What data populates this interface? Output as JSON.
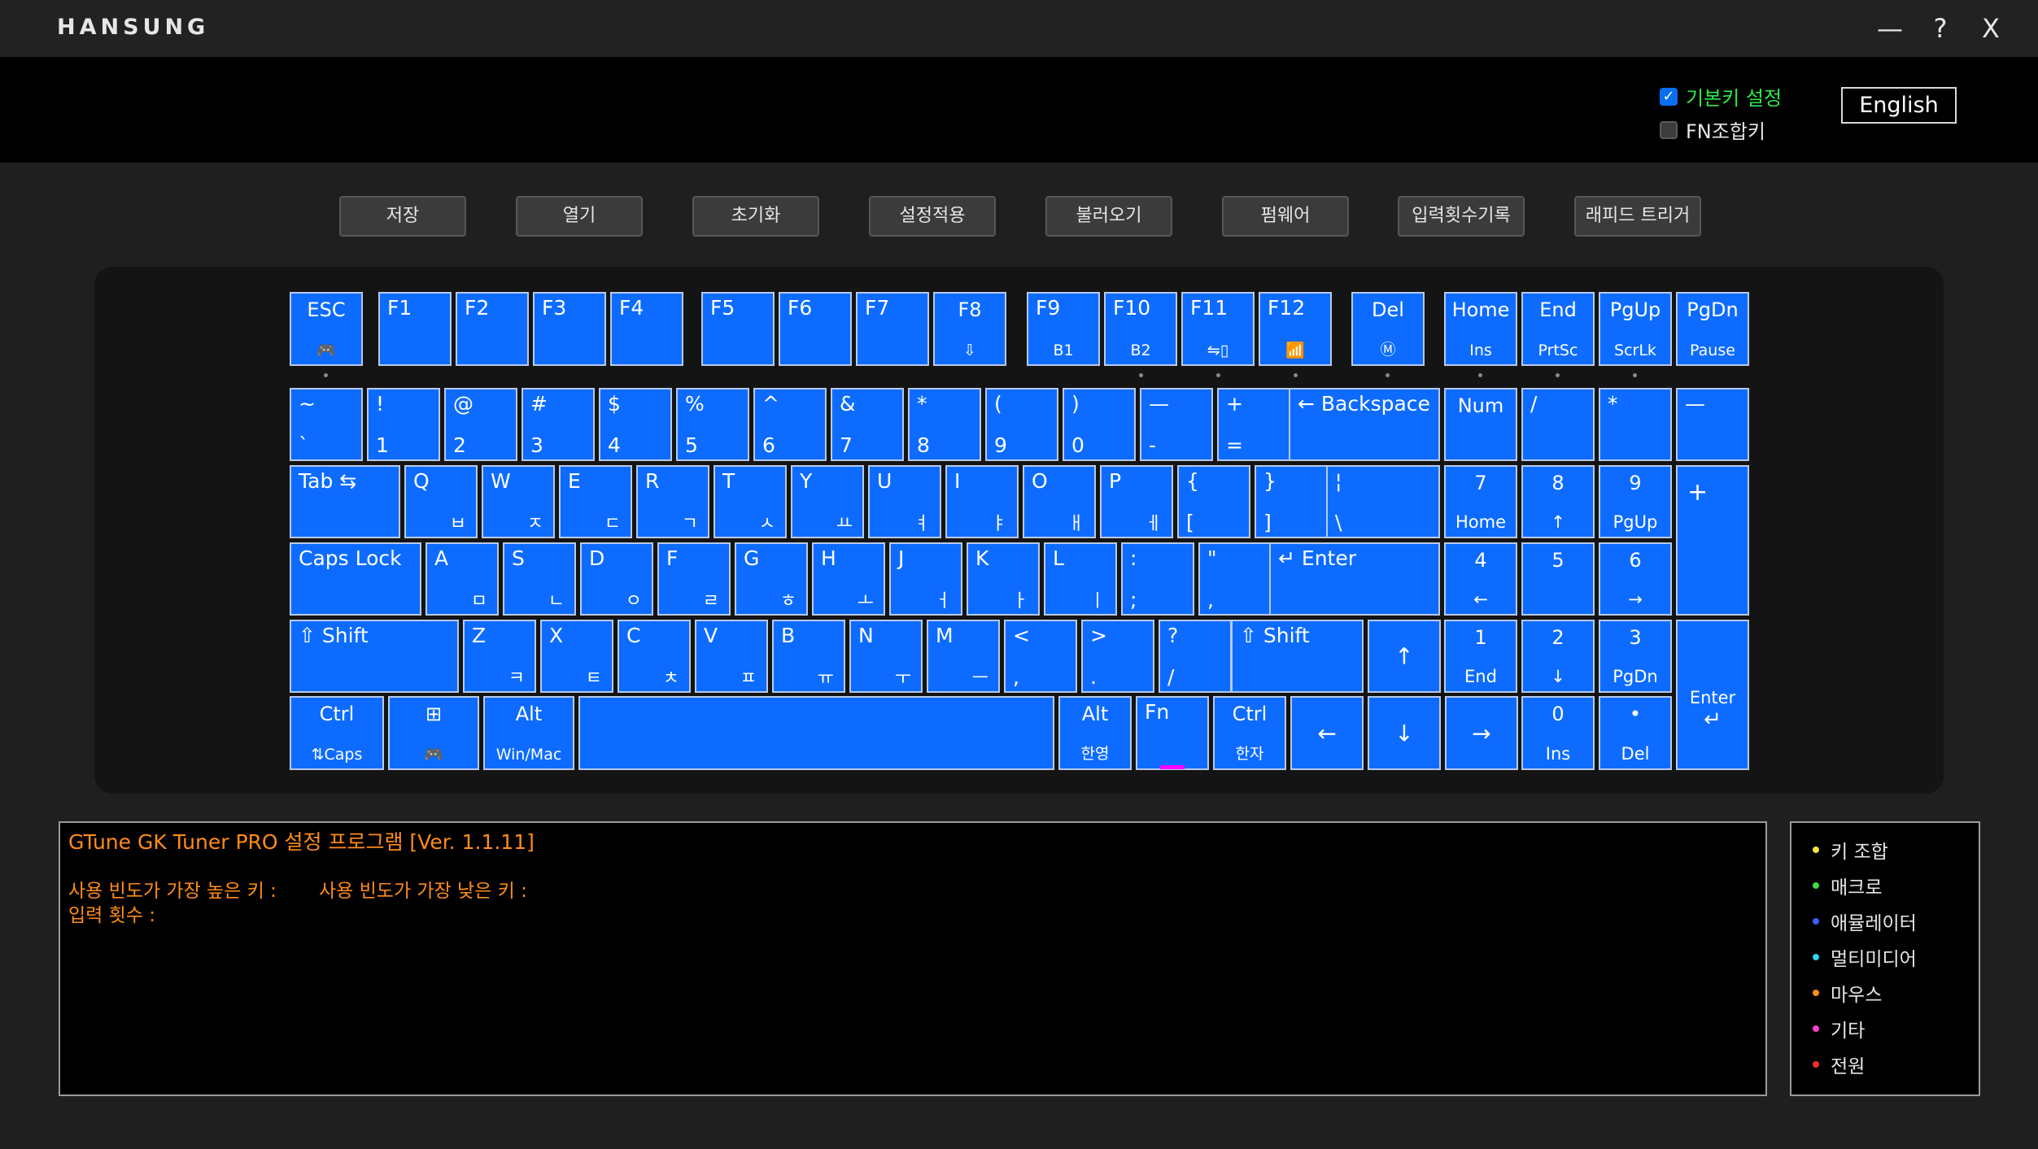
{
  "app": {
    "logo": "HANSUNG"
  },
  "window": {
    "minimize": "—",
    "help": "?",
    "close": "X"
  },
  "header": {
    "basic_key_label": "기본키 설정",
    "basic_key_checked": true,
    "fn_combo_label": "FN조합키",
    "fn_combo_checked": false,
    "language_button": "English",
    "accent_green": "#2ee84a"
  },
  "toolbar": {
    "buttons": [
      "저장",
      "열기",
      "초기화",
      "설정적용",
      "불러오기",
      "펌웨어",
      "입력횟수기록",
      "래피드 트리거"
    ]
  },
  "keyboard": {
    "key_color": "#0d6cff",
    "fn_indicator_color": "#ff00ff",
    "keys": {
      "esc": [
        "ESC",
        "🎮"
      ],
      "f1": [
        "F1"
      ],
      "f2": [
        "F2"
      ],
      "f3": [
        "F3"
      ],
      "f4": [
        "F4"
      ],
      "f5": [
        "F5"
      ],
      "f6": [
        "F6"
      ],
      "f7": [
        "F7"
      ],
      "f8": [
        "F8",
        "⇩"
      ],
      "f9": [
        "F9",
        "B1"
      ],
      "f10": [
        "F10",
        "B2"
      ],
      "f11": [
        "F11",
        "⇋▯"
      ],
      "f12": [
        "F12",
        "📶"
      ],
      "del": [
        "Del",
        "Ⓜ"
      ],
      "home": [
        "Home",
        "Ins"
      ],
      "end": [
        "End",
        "PrtSc"
      ],
      "pgup": [
        "PgUp",
        "ScrLk"
      ],
      "pgdn": [
        "PgDn",
        "Pause"
      ],
      "tilde": [
        "~",
        "`"
      ],
      "n1": [
        "!",
        "1"
      ],
      "n2": [
        "@",
        "2"
      ],
      "n3": [
        "#",
        "3"
      ],
      "n4": [
        "$",
        "4"
      ],
      "n5": [
        "%",
        "5"
      ],
      "n6": [
        "^",
        "6"
      ],
      "n7": [
        "&",
        "7"
      ],
      "n8": [
        "*",
        "8"
      ],
      "n9": [
        "(",
        "9"
      ],
      "n0": [
        ")",
        "0"
      ],
      "minus": [
        "—",
        "-"
      ],
      "equal": [
        "+",
        "="
      ],
      "backspace": [
        "← Backspace"
      ],
      "numlock": [
        "Num"
      ],
      "np_div": [
        "/"
      ],
      "np_mul": [
        "*"
      ],
      "np_minus": [
        "—"
      ],
      "tab": [
        "Tab ⇆"
      ],
      "q": [
        "Q",
        "ㅂ"
      ],
      "w": [
        "W",
        "ㅈ"
      ],
      "e": [
        "E",
        "ㄷ"
      ],
      "r": [
        "R",
        "ㄱ"
      ],
      "t": [
        "T",
        "ㅅ"
      ],
      "y": [
        "Y",
        "ㅛ"
      ],
      "u": [
        "U",
        "ㅕ"
      ],
      "i": [
        "I",
        "ㅑ"
      ],
      "o": [
        "O",
        "ㅐ"
      ],
      "p": [
        "P",
        "ㅔ"
      ],
      "lbrace": [
        "{",
        "["
      ],
      "rbrace": [
        "}",
        "]"
      ],
      "backslash": [
        "¦",
        "\\"
      ],
      "np7": [
        "7",
        "Home"
      ],
      "np8": [
        "8",
        "↑"
      ],
      "np9": [
        "9",
        "PgUp"
      ],
      "np_plus": [
        "+"
      ],
      "caps": [
        "Caps Lock"
      ],
      "a": [
        "A",
        "ㅁ"
      ],
      "s": [
        "S",
        "ㄴ"
      ],
      "d": [
        "D",
        "ㅇ"
      ],
      "f": [
        "F",
        "ㄹ"
      ],
      "g": [
        "G",
        "ㅎ"
      ],
      "h": [
        "H",
        "ㅗ"
      ],
      "j": [
        "J",
        "ㅓ"
      ],
      "k": [
        "K",
        "ㅏ"
      ],
      "l": [
        "L",
        "ㅣ"
      ],
      "semicolon": [
        ":",
        ";"
      ],
      "quote": [
        "\"",
        ","
      ],
      "enter": [
        "↵ Enter"
      ],
      "np4": [
        "4",
        "←"
      ],
      "np5": [
        "5"
      ],
      "np6": [
        "6",
        "→"
      ],
      "lshift": [
        "⇧ Shift"
      ],
      "z": [
        "Z",
        "ㅋ"
      ],
      "x": [
        "X",
        "ㅌ"
      ],
      "c": [
        "C",
        "ㅊ"
      ],
      "v": [
        "V",
        "ㅍ"
      ],
      "b": [
        "B",
        "ㅠ"
      ],
      "n": [
        "N",
        "ㅜ"
      ],
      "m": [
        "M",
        "ㅡ"
      ],
      "comma": [
        "<",
        ","
      ],
      "period": [
        ">",
        "."
      ],
      "slash": [
        "?",
        "/"
      ],
      "rshift": [
        "⇧ Shift"
      ],
      "up": [
        "↑"
      ],
      "np1": [
        "1",
        "End"
      ],
      "np2": [
        "2",
        "↓"
      ],
      "np3": [
        "3",
        "PgDn"
      ],
      "np_enter": [
        "Enter",
        "↵"
      ],
      "lctrl": [
        "Ctrl",
        "⇅Caps"
      ],
      "win": [
        "⊞",
        "🎮"
      ],
      "lalt": [
        "Alt",
        "Win/Mac"
      ],
      "space": [
        ""
      ],
      "ralt": [
        "Alt",
        "한영"
      ],
      "fn": [
        "Fn"
      ],
      "rctrl": [
        "Ctrl",
        "한자"
      ],
      "left": [
        "←"
      ],
      "down": [
        "↓"
      ],
      "right": [
        "→"
      ],
      "np0": [
        "0",
        "Ins"
      ],
      "np_dot": [
        "•",
        "Del"
      ]
    }
  },
  "info": {
    "title": "GTune GK Tuner PRO 설정 프로그램 [Ver. 1.1.11]",
    "most_used": "사용 빈도가 가장 높은 키 :",
    "least_used": "사용 빈도가 가장 낮은 키 :",
    "press_count": "입력 횟수 :",
    "text_color": "#ff8c1a"
  },
  "legend": [
    {
      "label": "키 조합",
      "color": "#f5e642"
    },
    {
      "label": "매크로",
      "color": "#3fdc3f"
    },
    {
      "label": "애뮬레이터",
      "color": "#3a5cff"
    },
    {
      "label": "멀티미디어",
      "color": "#2fd6f0"
    },
    {
      "label": "마우스",
      "color": "#ff8c1a"
    },
    {
      "label": "기타",
      "color": "#ff3ccf"
    },
    {
      "label": "전원",
      "color": "#ff2a2a"
    }
  ]
}
